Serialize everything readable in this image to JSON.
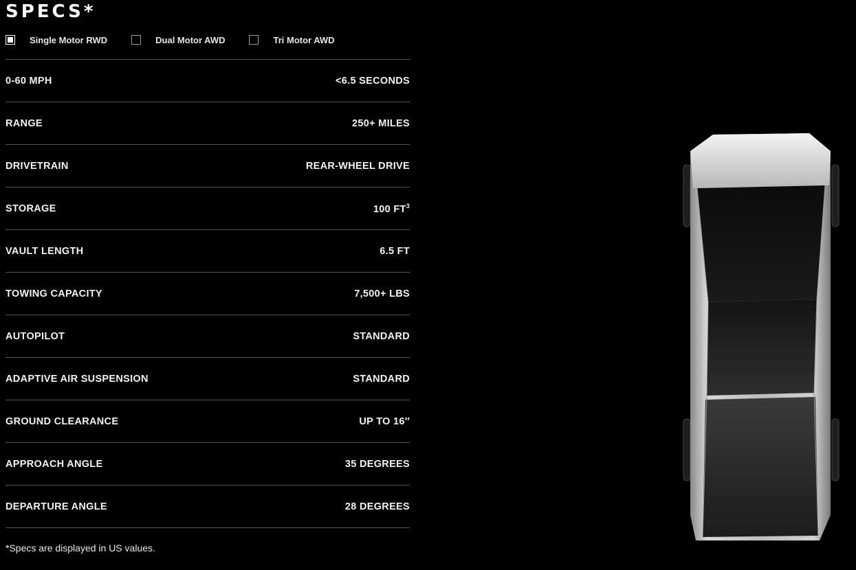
{
  "header": {
    "title": "SPECS*"
  },
  "options": [
    {
      "label": "Single Motor RWD",
      "checked": true
    },
    {
      "label": "Dual Motor AWD",
      "checked": false
    },
    {
      "label": "Tri Motor AWD",
      "checked": false
    }
  ],
  "specs": [
    {
      "label": "0-60 MPH",
      "value": "<6.5 SECONDS"
    },
    {
      "label": "RANGE",
      "value": "250+ MILES"
    },
    {
      "label": "DRIVETRAIN",
      "value": "REAR-WHEEL DRIVE"
    },
    {
      "label": "STORAGE",
      "value": "100 FT",
      "sup": "3"
    },
    {
      "label": "VAULT LENGTH",
      "value": "6.5 FT"
    },
    {
      "label": "TOWING CAPACITY",
      "value": "7,500+ LBS"
    },
    {
      "label": "AUTOPILOT",
      "value": "STANDARD"
    },
    {
      "label": "ADAPTIVE AIR SUSPENSION",
      "value": "STANDARD"
    },
    {
      "label": "GROUND CLEARANCE",
      "value": "UP TO 16″"
    },
    {
      "label": "APPROACH ANGLE",
      "value": "35 DEGREES"
    },
    {
      "label": "DEPARTURE ANGLE",
      "value": "28 DEGREES"
    }
  ],
  "footnote": "*Specs are displayed in US values."
}
